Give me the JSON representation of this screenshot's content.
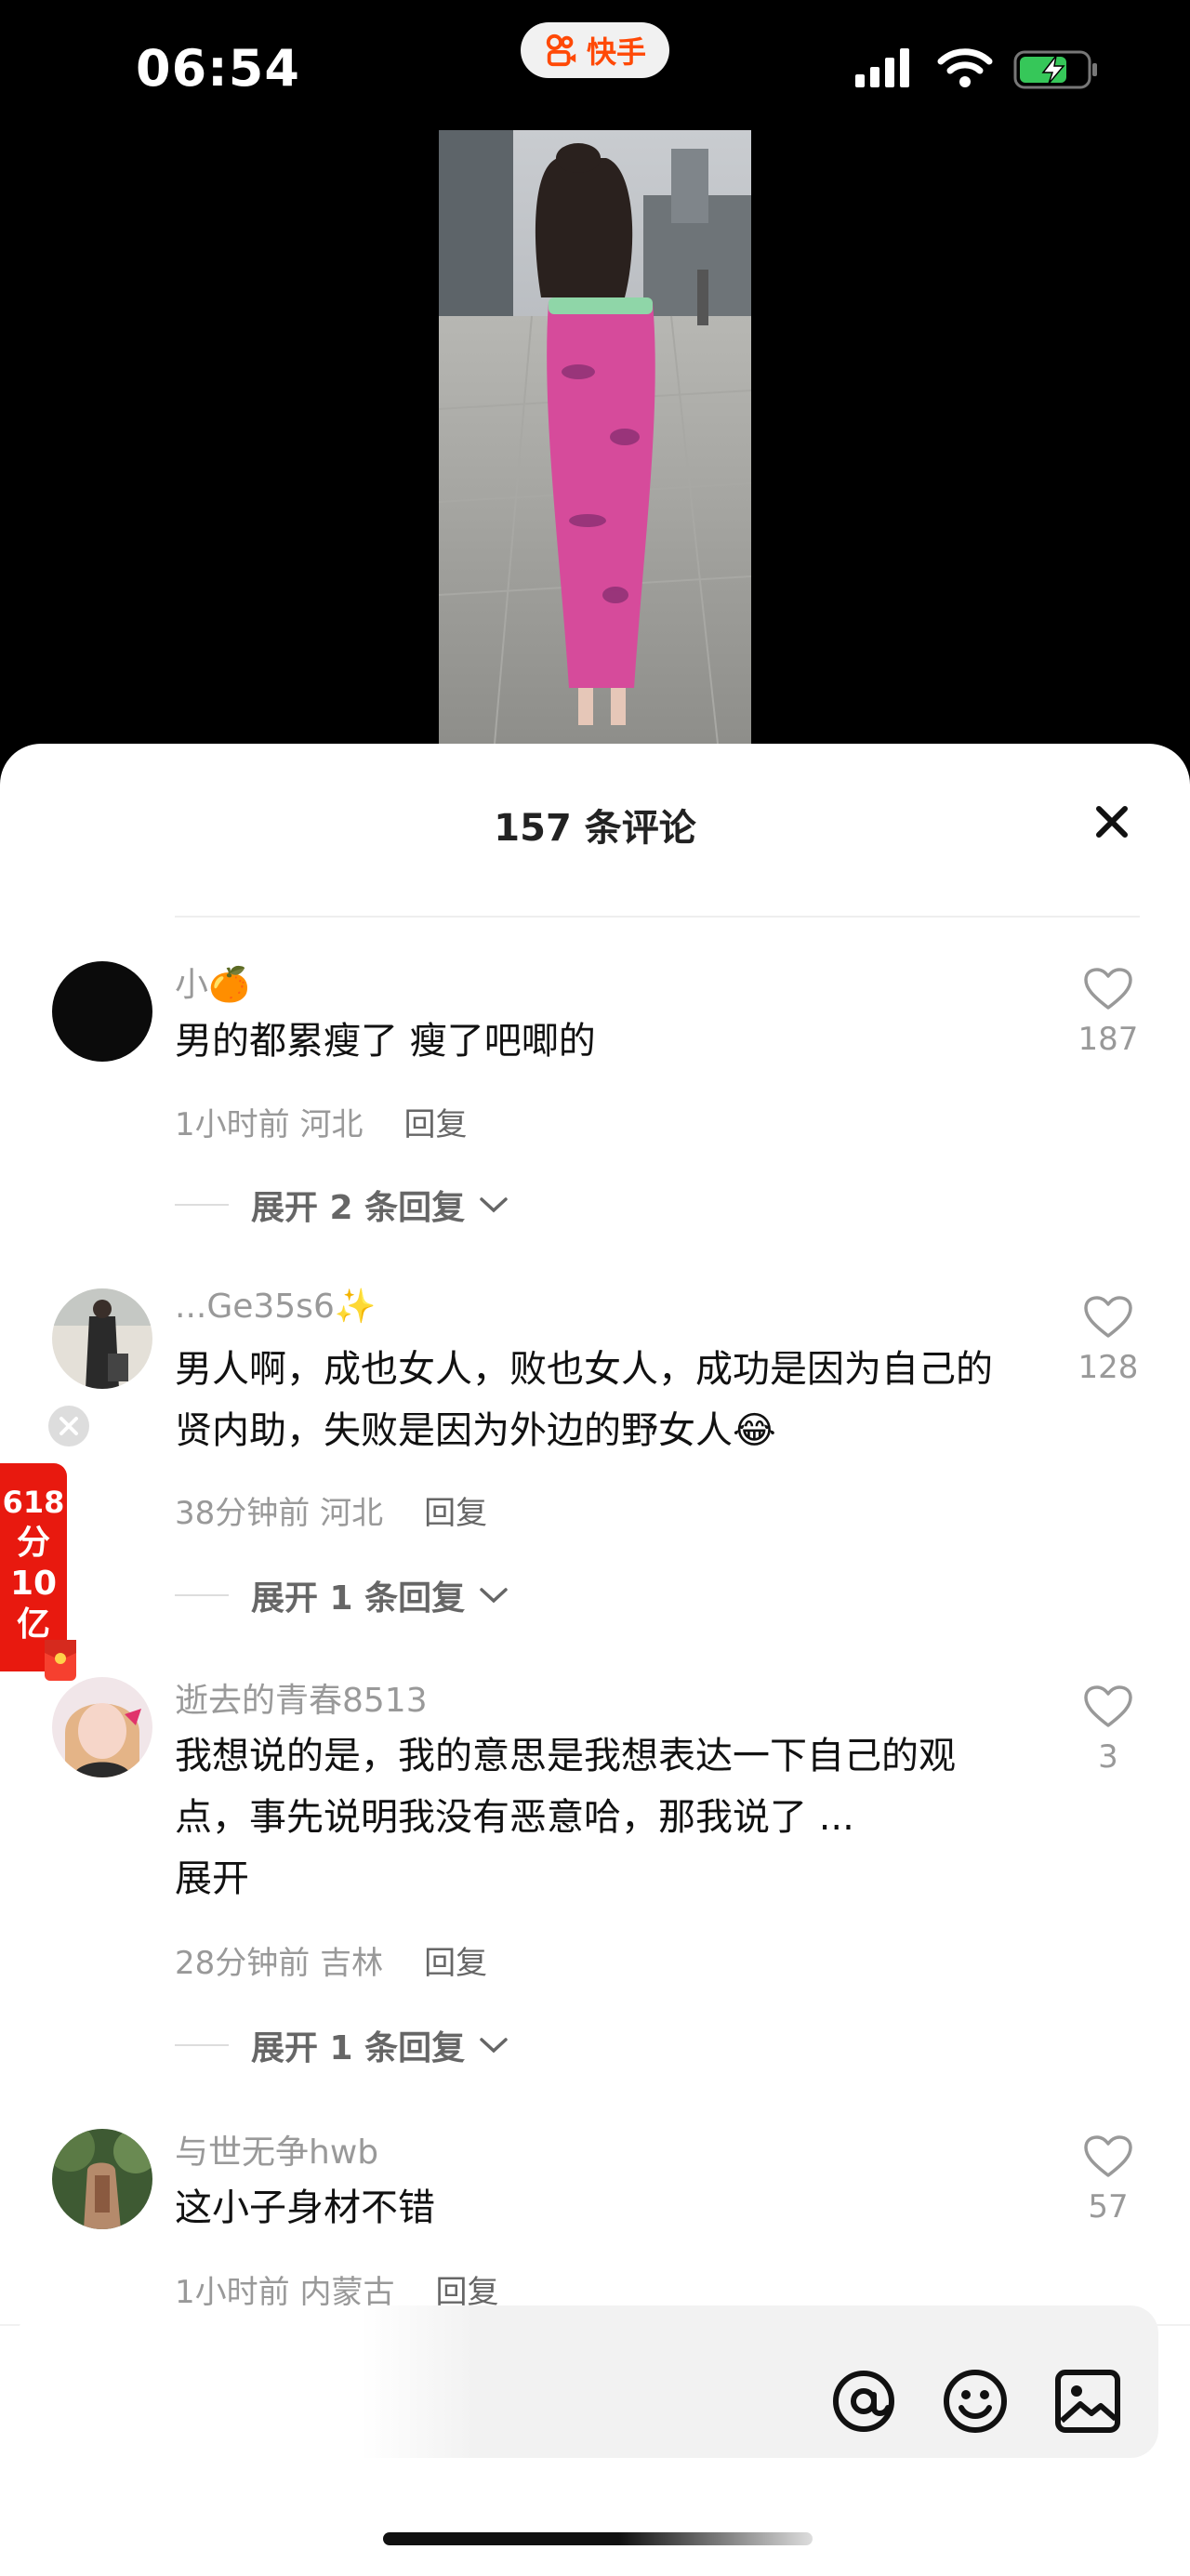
{
  "status_bar": {
    "time": "06:54",
    "app_name": "快手"
  },
  "sheet": {
    "title": "157 条评论"
  },
  "comments": [
    {
      "username": "小🍊",
      "text": "男的都累瘦了 瘦了吧唧的",
      "meta": "1小时前 河北",
      "reply": "回复",
      "likes": "187",
      "expand": "展开 2 条回复"
    },
    {
      "username": "...Ge35s6✨",
      "text": "男人啊，成也女人，败也女人，成功是因为自己的贤内助，失败是因为外边的野女人😂",
      "meta": "38分钟前 河北",
      "reply": "回复",
      "likes": "128",
      "expand": "展开 1 条回复"
    },
    {
      "username": "逝去的青春8513",
      "text": "我想说的是，我的意思是我想表达一下自己的观点，事先说明我没有恶意哈，那我说了 ...",
      "more": "展开",
      "meta": "28分钟前 吉林",
      "reply": "回复",
      "likes": "3",
      "expand": "展开 1 条回复"
    },
    {
      "username": "与世无争hwb",
      "text": "这小子身材不错",
      "meta": "1小时前 内蒙古",
      "reply": "回复",
      "likes": "57"
    }
  ],
  "promo": {
    "line1": "618",
    "line2": "分",
    "line3": "10",
    "line4": "亿"
  },
  "icons": {
    "mention": "at-icon",
    "emoji": "smile-icon",
    "image": "image-icon",
    "like": "heart-icon",
    "close": "close-icon"
  },
  "colors": {
    "brand": "#ff4906",
    "promo": "#e8190f"
  }
}
